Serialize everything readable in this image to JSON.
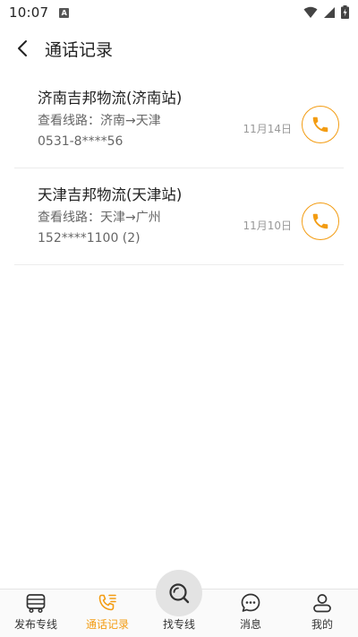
{
  "status_bar": {
    "time": "10:07",
    "notification_badge": "A"
  },
  "header": {
    "title": "通话记录",
    "back_icon": "chevron-left-icon"
  },
  "records": [
    {
      "name": "济南吉邦物流(济南站)",
      "route": "查看线路：济南→天津",
      "phone": "0531-8****56",
      "date": "11月14日"
    },
    {
      "name": "天津吉邦物流(天津站)",
      "route": "查看线路：天津→广州",
      "phone": "152****1100 (2)",
      "date": "11月10日"
    }
  ],
  "bottom_nav": {
    "items": [
      {
        "label": "发布专线",
        "icon": "truck-icon",
        "active": false
      },
      {
        "label": "通话记录",
        "icon": "phone-list-icon",
        "active": true
      },
      {
        "label": "找专线",
        "icon": "search-icon",
        "active": false
      },
      {
        "label": "消息",
        "icon": "chat-bubble-icon",
        "active": false
      },
      {
        "label": "我的",
        "icon": "user-icon",
        "active": false
      }
    ]
  },
  "colors": {
    "accent": "#f39c12",
    "text_primary": "#222222",
    "text_secondary": "#666666",
    "text_muted": "#999999"
  }
}
